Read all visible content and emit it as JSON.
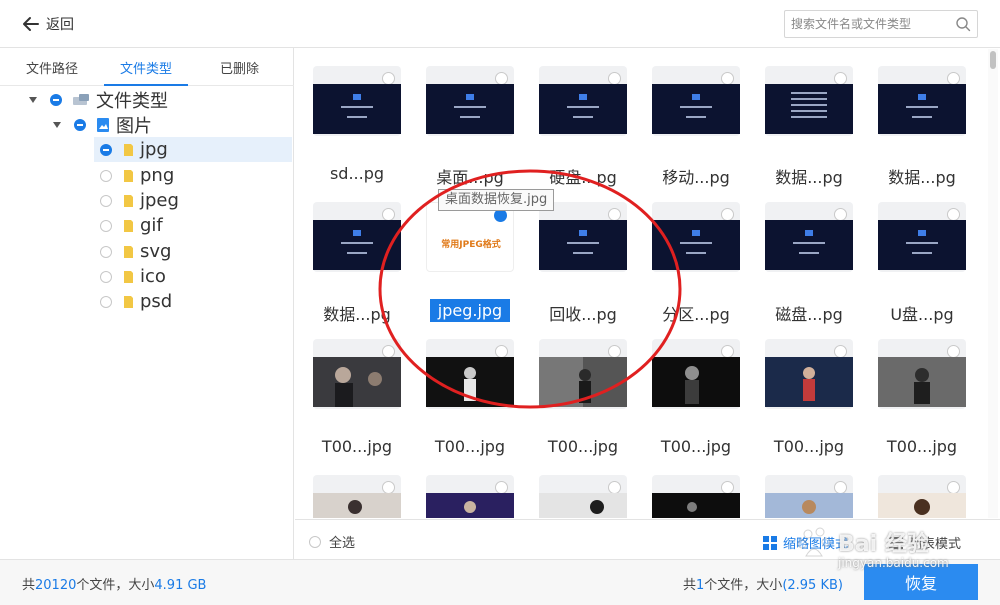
{
  "topbar": {
    "back_label": "返回",
    "search_placeholder": "搜索文件名或文件类型"
  },
  "tabs": [
    {
      "label": "文件路径",
      "active": false
    },
    {
      "label": "文件类型",
      "active": true
    },
    {
      "label": "已删除",
      "active": false
    }
  ],
  "tree": {
    "root_label": "文件类型",
    "group_label": "图片",
    "items": [
      "jpg",
      "png",
      "jpeg",
      "gif",
      "svg",
      "ico",
      "psd"
    ],
    "selected_item": "jpg"
  },
  "grid": {
    "row1": [
      "sd...pg",
      "桌面...pg",
      "硬盘...pg",
      "移动...pg",
      "数据...pg",
      "数据...pg"
    ],
    "row2": [
      "数据...pg",
      "jpeg.jpg",
      "回收...pg",
      "分区...pg",
      "磁盘...pg",
      "U盘...pg"
    ],
    "row3": [
      "T00...jpg",
      "T00...jpg",
      "T00...jpg",
      "T00...jpg",
      "T00...jpg",
      "T00...jpg"
    ],
    "selected_name": "jpeg.jpg",
    "selected_thumb_text": "常用JPEG格式",
    "tooltip": "桌面数据恢复.jpg"
  },
  "footer": {
    "select_all": "全选",
    "mode_thumbnail": "缩略图模式",
    "mode_list": "列表模式"
  },
  "status": {
    "total_prefix": "共",
    "total_count": "20120",
    "total_middle": "个文件，大小",
    "total_size": "4.91 GB",
    "sel_prefix": "共",
    "sel_count": "1",
    "sel_middle": "个文件，大小",
    "sel_size": "(2.95 KB)",
    "recover_label": "恢复"
  },
  "watermark": {
    "text": "Bai 经验",
    "url": "jingyan.baidu.com"
  },
  "colors": {
    "accent": "#1a7be6",
    "button": "#2b8bf0",
    "annotation": "#e02020"
  }
}
